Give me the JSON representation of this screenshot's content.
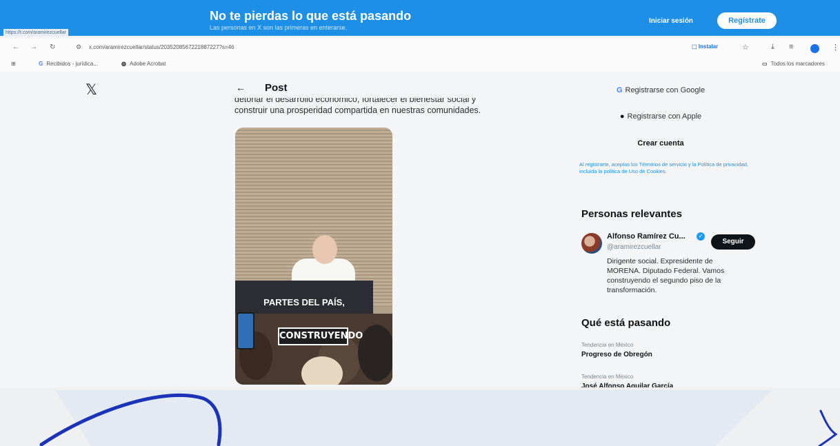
{
  "banner": {
    "title": "No te pierdas lo que está pasando",
    "subtitle": "Las personas en X son las primeras en enterarse.",
    "login_label": "Iniciar sesión",
    "register_label": "Regístrate",
    "status_url": "https://t.com/aramirezcuellar"
  },
  "browser": {
    "url": "x.com/aramirezcuellar/status/2035208567221887227?s=46",
    "install_label": "Instalar",
    "bookmarks": [
      "Recibidos - jurídica...",
      "Adobe Acrobat"
    ],
    "all_bookmarks_label": "Todos los marcadores"
  },
  "post": {
    "header": "Post",
    "text_line_1": "detonar el desarrollo económico, fortalecer el bienestar social y",
    "text_line_2": "construir una prosperidad compartida en nuestras comunidades.",
    "media_caption": "PARTES DEL PAÍS,",
    "media_sign": "CONSTRUYENDO"
  },
  "signup": {
    "google_label": "Registrarse con Google",
    "apple_label": "Registrarse con Apple",
    "create_label": "Crear cuenta",
    "legal_text": "Al registrarte, aceptas los Términos de servicio y la Política de privacidad, incluida la política de Uso de Cookies."
  },
  "relevant": {
    "title": "Personas relevantes",
    "name": "Alfonso Ramírez Cu...",
    "handle": "@aramirezcuellar",
    "follow_label": "Seguir",
    "bio": "Dirigente social. Expresidente de MORENA. Diputado Federal. Vamos construyendo el segundo piso de la transformación."
  },
  "trends": {
    "title": "Qué está pasando",
    "items": [
      {
        "category": "Tendencia en México",
        "name": "Progreso de Obregón"
      },
      {
        "category": "Tendencia en México",
        "name": "José Alfonso Aguilar García"
      }
    ]
  },
  "colors": {
    "accent": "#1d8fe6",
    "annotation_ink": "#1a33b8"
  }
}
